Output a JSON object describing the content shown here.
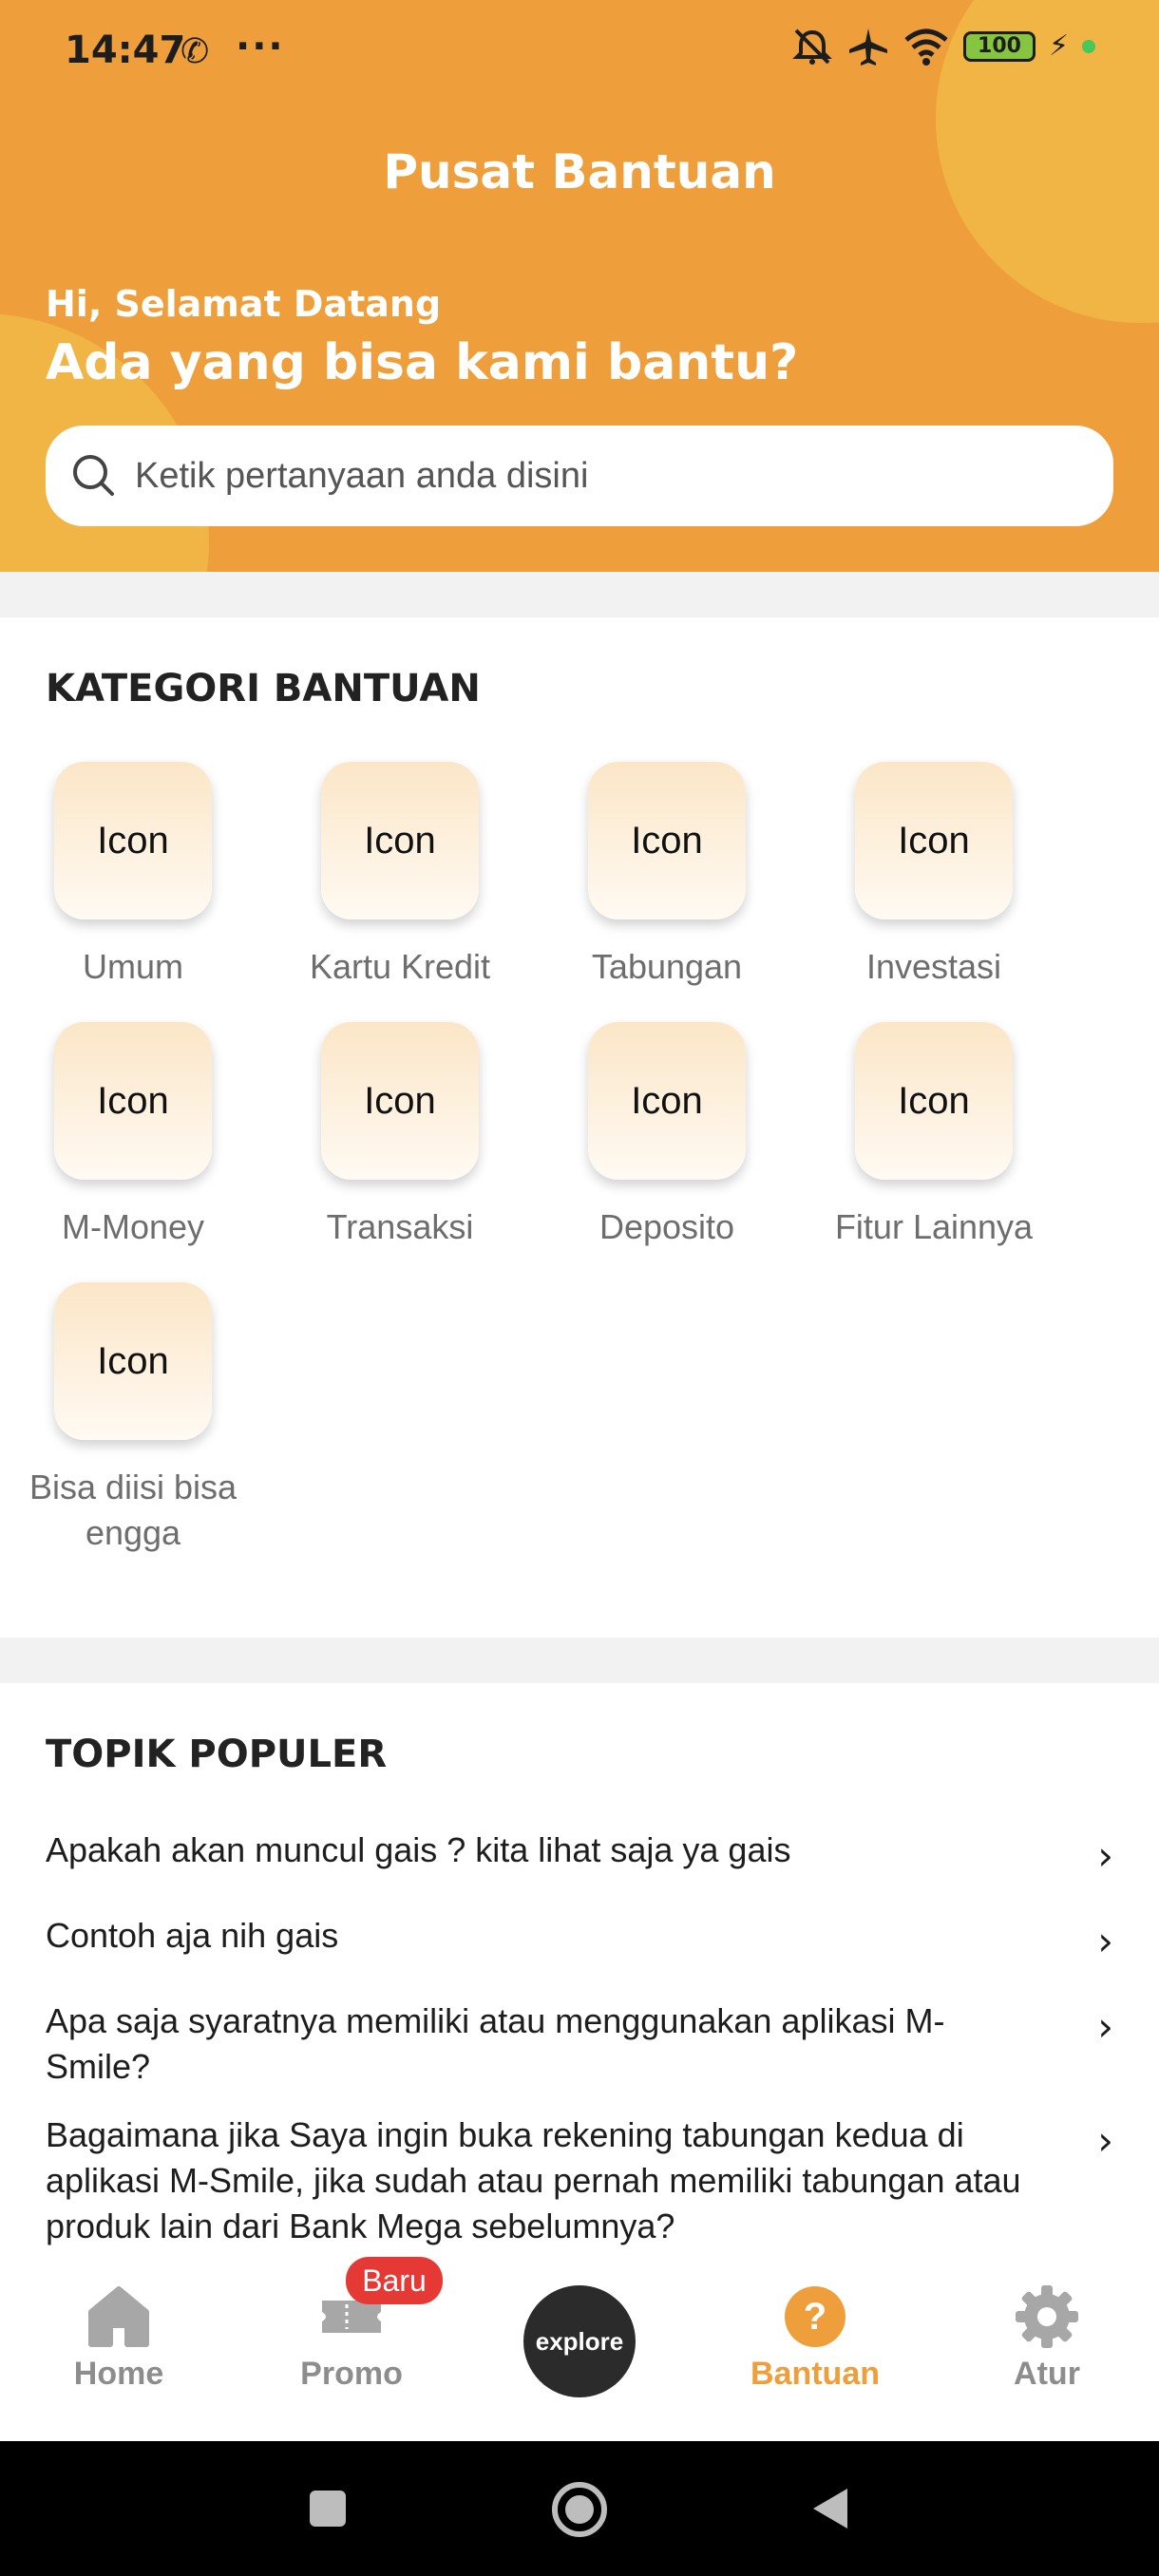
{
  "status_bar": {
    "time": "14:47",
    "battery": "100",
    "icons": [
      "whatsapp-icon",
      "more-dots-icon",
      "mute-icon",
      "airplane-icon",
      "wifi-icon",
      "battery-icon",
      "charging-icon"
    ]
  },
  "header": {
    "title": "Pusat Bantuan",
    "greeting": "Hi, Selamat Datang",
    "subtitle": "Ada yang bisa kami bantu?",
    "colors": {
      "primary": "#ee9f3c",
      "blob": "#f0b544"
    }
  },
  "search": {
    "placeholder": "Ketik pertanyaan anda disini"
  },
  "kategori": {
    "title": "KATEGORI BANTUAN",
    "icon_text": "Icon",
    "items": [
      {
        "label": "Umum"
      },
      {
        "label": "Kartu Kredit"
      },
      {
        "label": "Tabungan"
      },
      {
        "label": "Investasi"
      },
      {
        "label": "M-Money"
      },
      {
        "label": "Transaksi"
      },
      {
        "label": "Deposito"
      },
      {
        "label": "Fitur Lainnya"
      },
      {
        "label": "Bisa diisi bisa engga"
      }
    ]
  },
  "topik": {
    "title": "TOPIK POPULER",
    "items": [
      {
        "question": "Apakah akan muncul gais ? kita lihat saja ya gais"
      },
      {
        "question": "Contoh aja nih gais"
      },
      {
        "question": "Apa saja syaratnya memiliki atau menggunakan aplikasi M-Smile?"
      },
      {
        "question": "Bagaimana jika Saya ingin buka rekening tabungan kedua di aplikasi M-Smile, jika sudah atau pernah memiliki tabungan atau produk lain dari Bank Mega sebelumnya?"
      }
    ]
  },
  "bottom_nav": {
    "items": [
      {
        "label": "Home",
        "icon": "home-icon"
      },
      {
        "label": "Promo",
        "icon": "promo-ticket-icon",
        "badge": "Baru"
      },
      {
        "label": "explore",
        "icon": "explore-button"
      },
      {
        "label": "Bantuan",
        "icon": "help-icon",
        "active": true
      },
      {
        "label": "Atur",
        "icon": "gear-icon"
      }
    ],
    "active_color": "#ee9f3c"
  },
  "system_nav": [
    "recents-icon",
    "home-circle-icon",
    "back-icon"
  ]
}
